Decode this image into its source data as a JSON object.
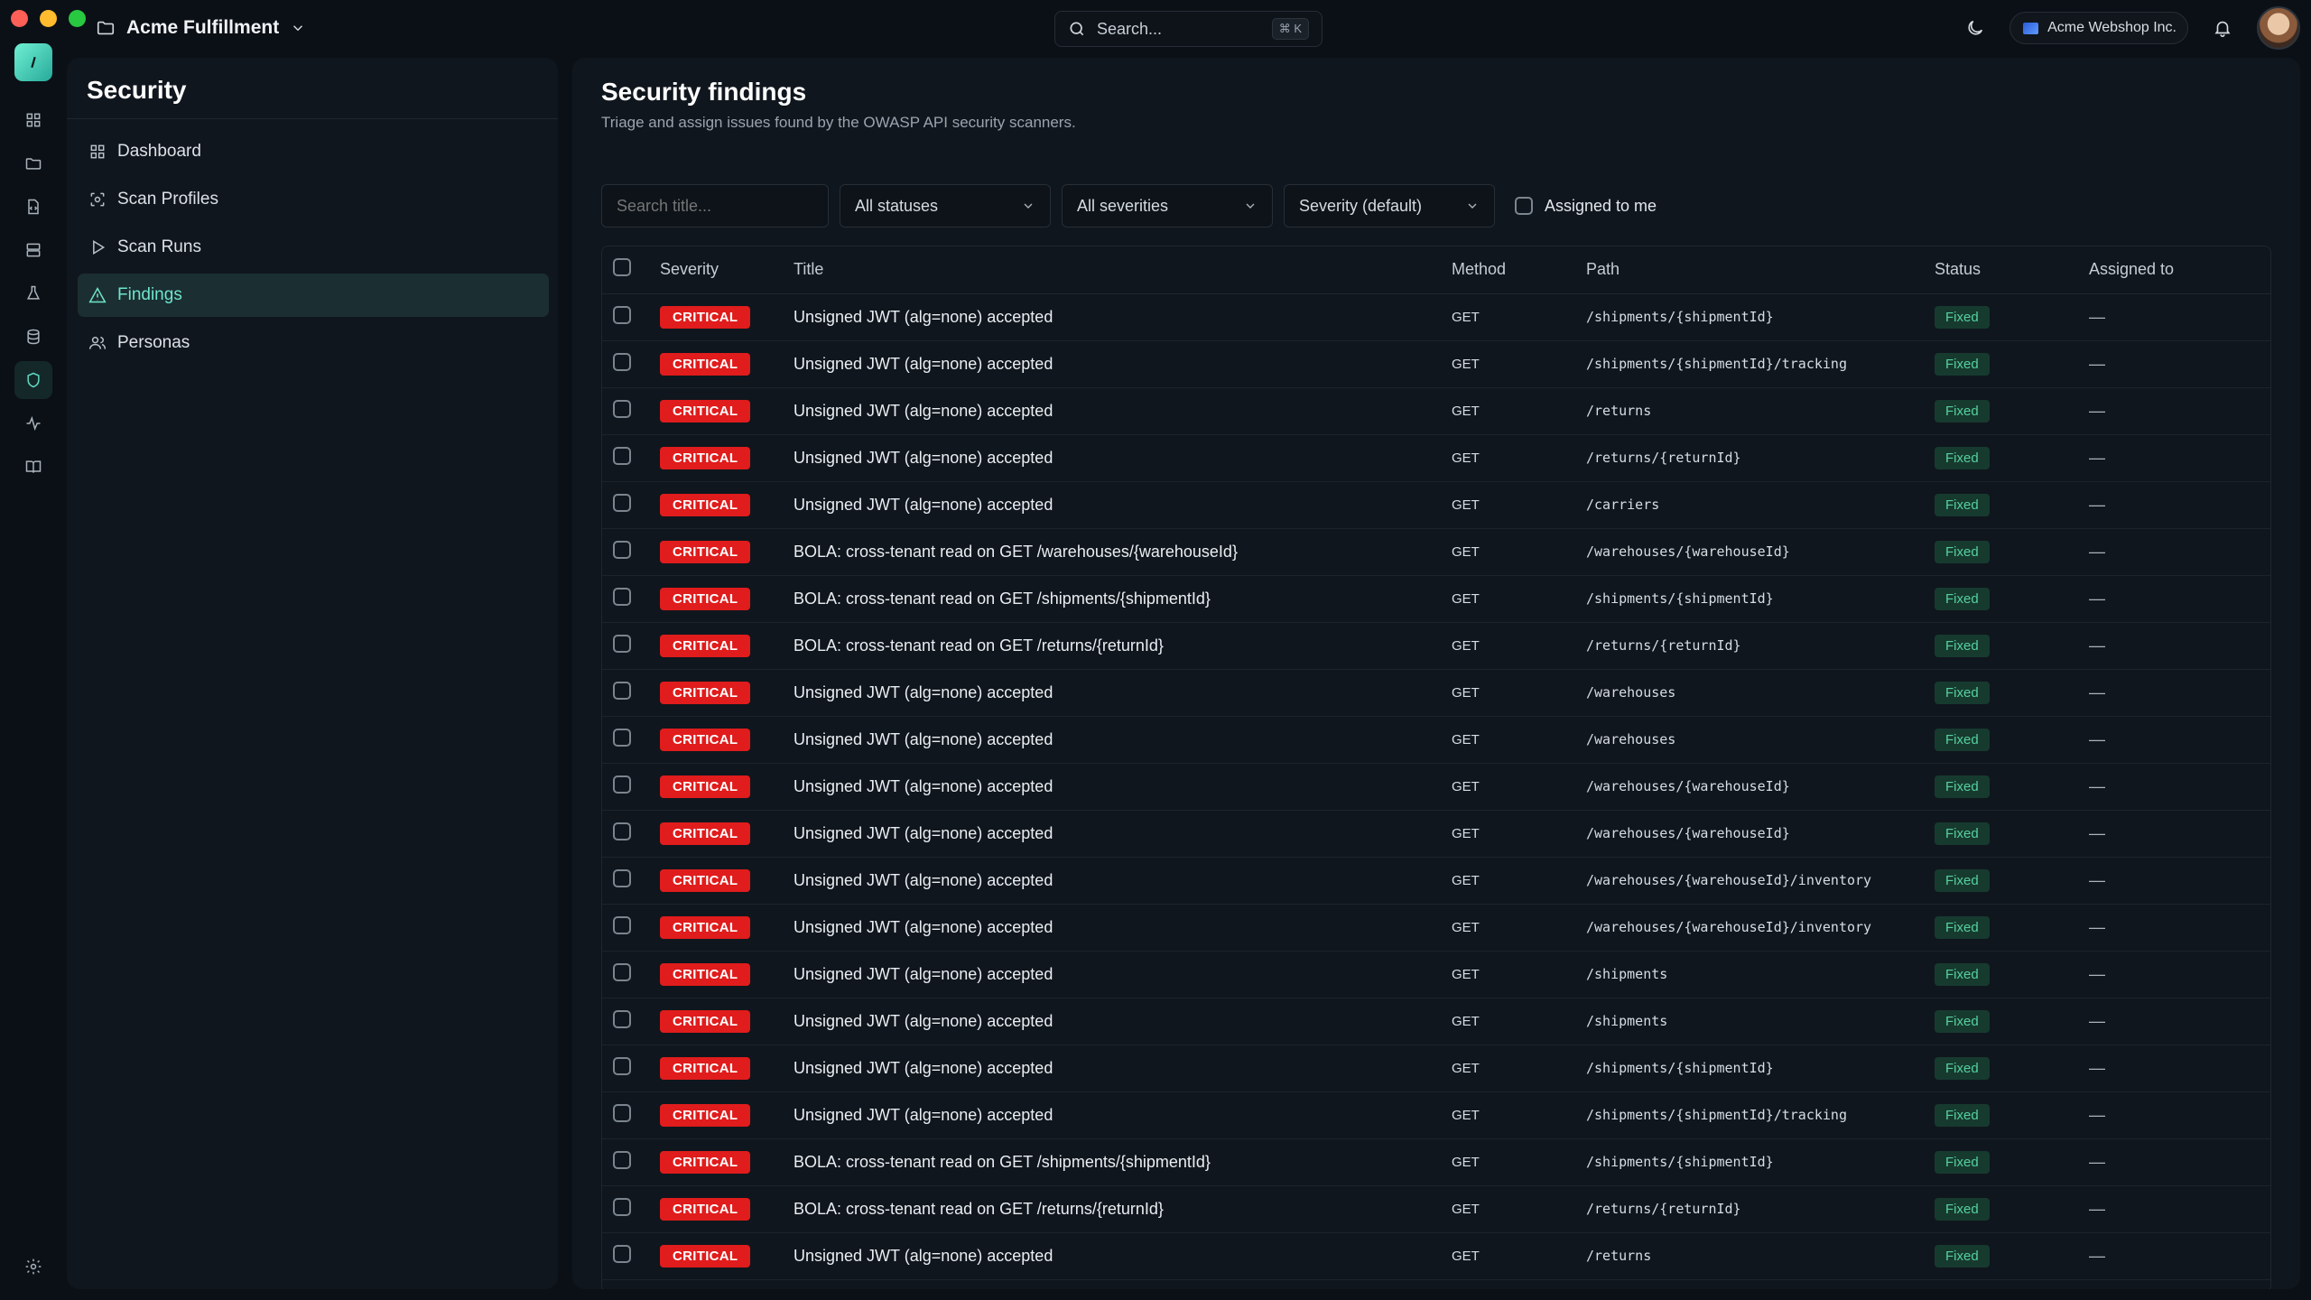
{
  "window": {
    "workspace_name": "Acme Fulfillment",
    "search_placeholder": "Search...",
    "search_shortcut": "⌘ K",
    "org_name": "Acme Webshop Inc."
  },
  "sidebar": {
    "title": "Security",
    "items": [
      {
        "label": "Dashboard",
        "icon": "dashboard-icon",
        "active": false
      },
      {
        "label": "Scan Profiles",
        "icon": "scan-icon",
        "active": false
      },
      {
        "label": "Scan Runs",
        "icon": "play-icon",
        "active": false
      },
      {
        "label": "Findings",
        "icon": "warning-icon",
        "active": true
      },
      {
        "label": "Personas",
        "icon": "users-icon",
        "active": false
      }
    ]
  },
  "main": {
    "title": "Security findings",
    "subtitle": "Triage and assign issues found by the OWASP API security scanners.",
    "filters": {
      "search_placeholder": "Search title...",
      "status": "All statuses",
      "severity": "All severities",
      "sort": "Severity (default)",
      "assigned_label": "Assigned to me"
    },
    "columns": [
      "Severity",
      "Title",
      "Method",
      "Path",
      "Status",
      "Assigned to"
    ],
    "rows": [
      {
        "severity": "CRITICAL",
        "title": "Unsigned JWT (alg=none) accepted",
        "method": "GET",
        "path": "/shipments/{shipmentId}",
        "status": "Fixed",
        "assigned": "—"
      },
      {
        "severity": "CRITICAL",
        "title": "Unsigned JWT (alg=none) accepted",
        "method": "GET",
        "path": "/shipments/{shipmentId}/tracking",
        "status": "Fixed",
        "assigned": "—"
      },
      {
        "severity": "CRITICAL",
        "title": "Unsigned JWT (alg=none) accepted",
        "method": "GET",
        "path": "/returns",
        "status": "Fixed",
        "assigned": "—"
      },
      {
        "severity": "CRITICAL",
        "title": "Unsigned JWT (alg=none) accepted",
        "method": "GET",
        "path": "/returns/{returnId}",
        "status": "Fixed",
        "assigned": "—"
      },
      {
        "severity": "CRITICAL",
        "title": "Unsigned JWT (alg=none) accepted",
        "method": "GET",
        "path": "/carriers",
        "status": "Fixed",
        "assigned": "—"
      },
      {
        "severity": "CRITICAL",
        "title": "BOLA: cross-tenant read on GET /warehouses/{warehouseId}",
        "method": "GET",
        "path": "/warehouses/{warehouseId}",
        "status": "Fixed",
        "assigned": "—"
      },
      {
        "severity": "CRITICAL",
        "title": "BOLA: cross-tenant read on GET /shipments/{shipmentId}",
        "method": "GET",
        "path": "/shipments/{shipmentId}",
        "status": "Fixed",
        "assigned": "—"
      },
      {
        "severity": "CRITICAL",
        "title": "BOLA: cross-tenant read on GET /returns/{returnId}",
        "method": "GET",
        "path": "/returns/{returnId}",
        "status": "Fixed",
        "assigned": "—"
      },
      {
        "severity": "CRITICAL",
        "title": "Unsigned JWT (alg=none) accepted",
        "method": "GET",
        "path": "/warehouses",
        "status": "Fixed",
        "assigned": "—"
      },
      {
        "severity": "CRITICAL",
        "title": "Unsigned JWT (alg=none) accepted",
        "method": "GET",
        "path": "/warehouses",
        "status": "Fixed",
        "assigned": "—"
      },
      {
        "severity": "CRITICAL",
        "title": "Unsigned JWT (alg=none) accepted",
        "method": "GET",
        "path": "/warehouses/{warehouseId}",
        "status": "Fixed",
        "assigned": "—"
      },
      {
        "severity": "CRITICAL",
        "title": "Unsigned JWT (alg=none) accepted",
        "method": "GET",
        "path": "/warehouses/{warehouseId}",
        "status": "Fixed",
        "assigned": "—"
      },
      {
        "severity": "CRITICAL",
        "title": "Unsigned JWT (alg=none) accepted",
        "method": "GET",
        "path": "/warehouses/{warehouseId}/inventory",
        "status": "Fixed",
        "assigned": "—"
      },
      {
        "severity": "CRITICAL",
        "title": "Unsigned JWT (alg=none) accepted",
        "method": "GET",
        "path": "/warehouses/{warehouseId}/inventory",
        "status": "Fixed",
        "assigned": "—"
      },
      {
        "severity": "CRITICAL",
        "title": "Unsigned JWT (alg=none) accepted",
        "method": "GET",
        "path": "/shipments",
        "status": "Fixed",
        "assigned": "—"
      },
      {
        "severity": "CRITICAL",
        "title": "Unsigned JWT (alg=none) accepted",
        "method": "GET",
        "path": "/shipments",
        "status": "Fixed",
        "assigned": "—"
      },
      {
        "severity": "CRITICAL",
        "title": "Unsigned JWT (alg=none) accepted",
        "method": "GET",
        "path": "/shipments/{shipmentId}",
        "status": "Fixed",
        "assigned": "—"
      },
      {
        "severity": "CRITICAL",
        "title": "Unsigned JWT (alg=none) accepted",
        "method": "GET",
        "path": "/shipments/{shipmentId}/tracking",
        "status": "Fixed",
        "assigned": "—"
      },
      {
        "severity": "CRITICAL",
        "title": "BOLA: cross-tenant read on GET /shipments/{shipmentId}",
        "method": "GET",
        "path": "/shipments/{shipmentId}",
        "status": "Fixed",
        "assigned": "—"
      },
      {
        "severity": "CRITICAL",
        "title": "BOLA: cross-tenant read on GET /returns/{returnId}",
        "method": "GET",
        "path": "/returns/{returnId}",
        "status": "Fixed",
        "assigned": "—"
      },
      {
        "severity": "CRITICAL",
        "title": "Unsigned JWT (alg=none) accepted",
        "method": "GET",
        "path": "/returns",
        "status": "Fixed",
        "assigned": "—"
      }
    ]
  },
  "colors": {
    "accent": "#6ee6cb",
    "critical": "#e01c1c",
    "fixed_bg": "#173a2f",
    "fixed_text": "#55d19f"
  }
}
